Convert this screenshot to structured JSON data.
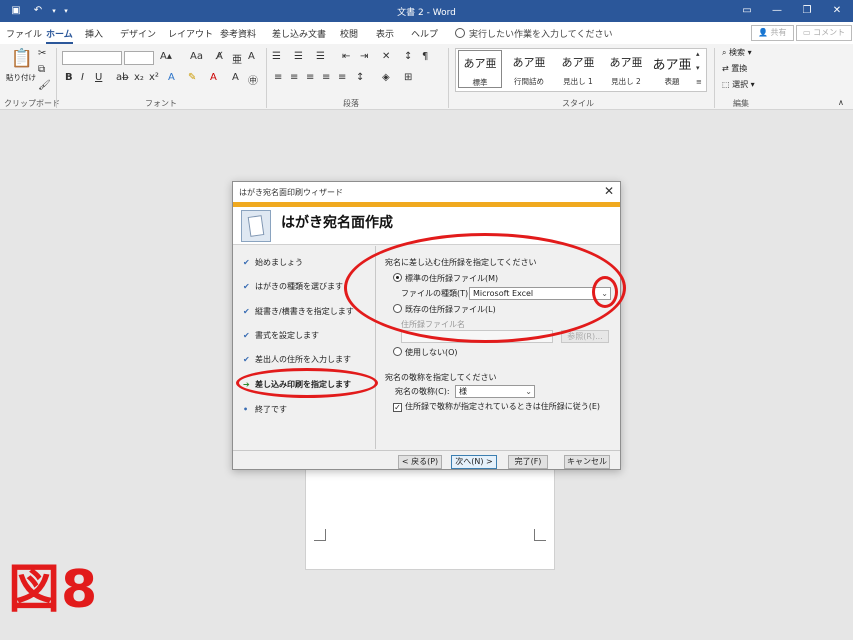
{
  "titlebar": {
    "document_title": "文書 2 - Word",
    "save_icon": "save-icon",
    "undo_icon": "undo-icon",
    "customize_icon": "customize-quick-access-icon"
  },
  "tabs": [
    {
      "label": "ファイル"
    },
    {
      "label": "ホーム"
    },
    {
      "label": "挿入"
    },
    {
      "label": "デザイン"
    },
    {
      "label": "レイアウト"
    },
    {
      "label": "参考資料"
    },
    {
      "label": "差し込み文書"
    },
    {
      "label": "校閲"
    },
    {
      "label": "表示"
    },
    {
      "label": "ヘルプ"
    }
  ],
  "tell_me": "実行したい作業を入力してください",
  "share_label": "共有",
  "comment_label": "コメント",
  "ribbon": {
    "clipboard": {
      "paste_label": "貼り付け",
      "group_label": "クリップボード"
    },
    "font": {
      "group_label": "フォント",
      "bold": "B",
      "italic": "I",
      "underline": "U"
    },
    "paragraph": {
      "group_label": "段落"
    },
    "styles": {
      "group_label": "スタイル",
      "items": [
        {
          "sample": "あア亜",
          "name": "標準"
        },
        {
          "sample": "あア亜",
          "name": "行間詰め"
        },
        {
          "sample": "あア亜",
          "name": "見出し 1"
        },
        {
          "sample": "あア亜",
          "name": "見出し 2"
        },
        {
          "sample": "あア亜",
          "name": "表題"
        }
      ]
    },
    "editing": {
      "group_label": "編集",
      "find": "検索",
      "replace": "置換",
      "select": "選択"
    }
  },
  "dialog": {
    "title": "はがき宛名面印刷ウィザード",
    "heading": "はがき宛名面作成",
    "steps": [
      {
        "label": "始めましょう",
        "state": "done"
      },
      {
        "label": "はがきの種類を選びます",
        "state": "done"
      },
      {
        "label": "縦書き/横書きを指定します",
        "state": "done"
      },
      {
        "label": "書式を設定します",
        "state": "done"
      },
      {
        "label": "差出人の住所を入力します",
        "state": "done"
      },
      {
        "label": "差し込み印刷を指定します",
        "state": "current"
      },
      {
        "label": "終了です",
        "state": "pending"
      }
    ],
    "address_section_label": "宛名に差し込む住所録を指定してください",
    "radio_standard": "標準の住所録ファイル(M)",
    "file_type_label": "ファイルの種類(T):",
    "file_type_value": "Microsoft Excel",
    "radio_existing": "既存の住所録ファイル(L)",
    "address_file_label": "住所録ファイル名",
    "browse_button": "参照(R)...",
    "radio_none": "使用しない(O)",
    "honorific_section_label": "宛名の敬称を指定してください",
    "honorific_label": "宛名の敬称(C):",
    "honorific_value": "様",
    "honorific_checkbox": "住所録で敬称が指定されているときは住所録に従う(E)",
    "back_button": "< 戻る(P)",
    "next_button": "次へ(N) >",
    "finish_button": "完了(F)",
    "cancel_button": "キャンセル"
  },
  "figure_label": "図8",
  "colors": {
    "word_blue": "#2b579a",
    "annotation_red": "#e21b1b",
    "wizard_stripe": "#f0a91f"
  }
}
